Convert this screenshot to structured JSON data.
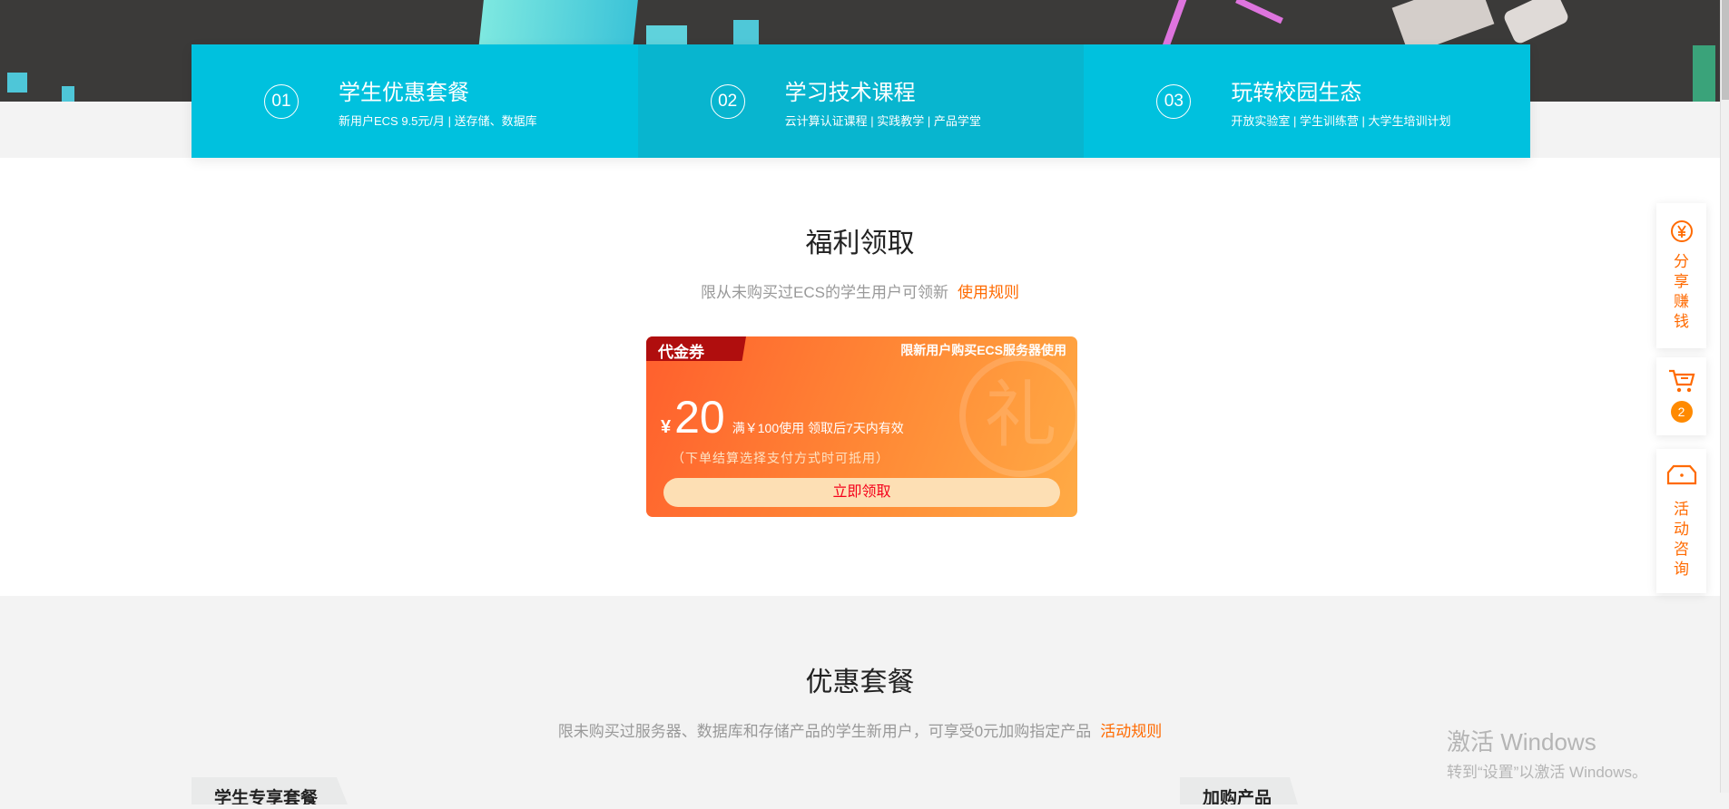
{
  "features": [
    {
      "num": "01",
      "title": "学生优惠套餐",
      "desc": "新用户ECS 9.5元/月 | 送存储、数据库"
    },
    {
      "num": "02",
      "title": "学习技术课程",
      "desc": "云计算认证课程 | 实践教学 | 产品学堂"
    },
    {
      "num": "03",
      "title": "玩转校园生态",
      "desc": "开放实验室 | 学生训练营 | 大学生培训计划"
    }
  ],
  "welfare": {
    "title": "福利领取",
    "subtitle": "限从未购买过ECS的学生用户可领新",
    "rules_link": "使用规则"
  },
  "coupon": {
    "tag": "代金券",
    "limit": "限新用户购买ECS服务器使用",
    "watermark": "礼",
    "currency": "¥",
    "amount": "20",
    "condition": "满￥100使用 领取后7天内有效",
    "note": "（下单结算选择支付方式时可抵用）",
    "claim_button": "立即领取"
  },
  "packages": {
    "title": "优惠套餐",
    "subtitle": "限未购买过服务器、数据库和存储产品的学生新用户，可享受0元加购指定产品",
    "rules_link": "活动规则"
  },
  "tabs": [
    "学生专享套餐",
    "加购产品"
  ],
  "sidebar": {
    "share": "分享赚钱",
    "cart_count": "2",
    "consult": "活动咨询"
  },
  "watermark": {
    "line1": "激活 Windows",
    "line2": "转到“设置”以激活 Windows。"
  },
  "colors": {
    "accent": "#ff6a00",
    "cyan": "#00c1de"
  }
}
